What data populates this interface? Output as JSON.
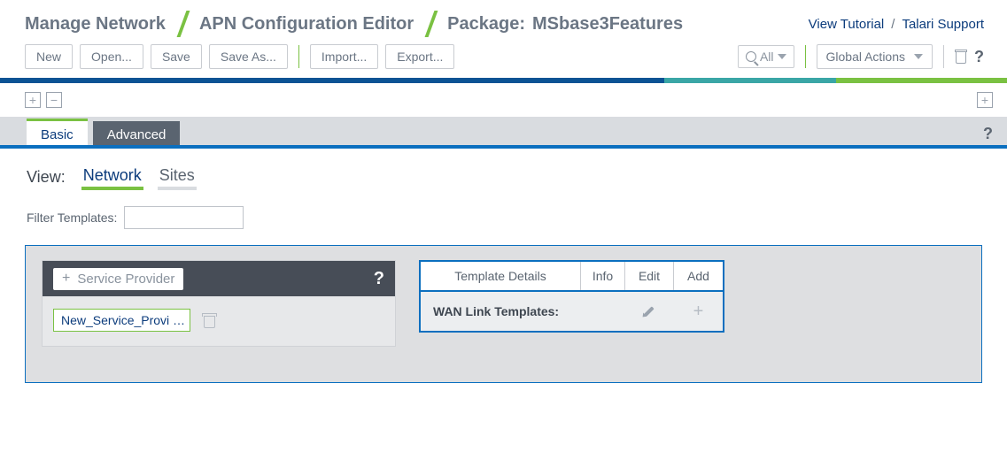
{
  "breadcrumb": {
    "a": "Manage Network",
    "b": "APN Configuration Editor",
    "c_label": "Package:",
    "c_value": "MSbase3Features"
  },
  "header_links": {
    "tutorial": "View Tutorial",
    "support": "Talari Support"
  },
  "toolbar": {
    "new": "New",
    "open": "Open...",
    "save": "Save",
    "saveas": "Save As...",
    "import": "Import...",
    "export": "Export...",
    "search_label": "All",
    "global_actions": "Global Actions"
  },
  "tabs": {
    "basic": "Basic",
    "advanced": "Advanced"
  },
  "view": {
    "label": "View:",
    "network": "Network",
    "sites": "Sites"
  },
  "filter": {
    "label": "Filter Templates:",
    "value": ""
  },
  "service_provider": {
    "add_label": "Service Provider",
    "item_display": "New_Service_Provi …"
  },
  "template_table": {
    "h1": "Template Details",
    "h2": "Info",
    "h3": "Edit",
    "h4": "Add",
    "row_label": "WAN Link Templates:"
  }
}
